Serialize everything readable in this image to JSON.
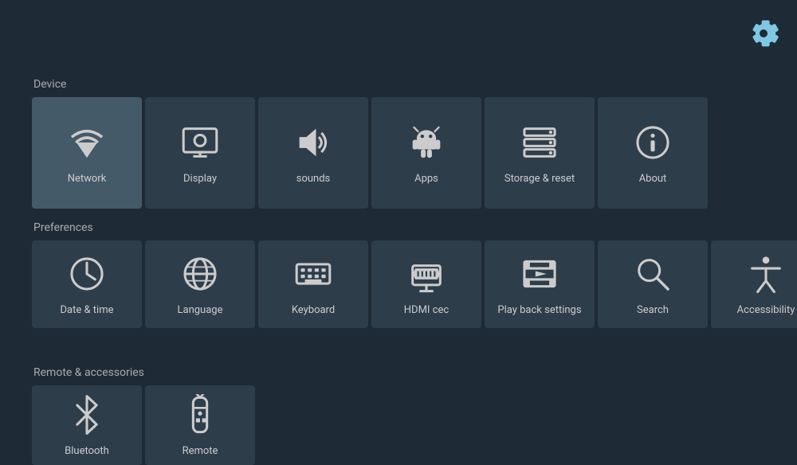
{
  "settings_icon": "gear-icon",
  "sections": {
    "device": {
      "label": "Device",
      "tiles": [
        {
          "id": "network",
          "label": "Network",
          "icon": "wifi",
          "active": true
        },
        {
          "id": "display",
          "label": "Display",
          "icon": "display",
          "active": false
        },
        {
          "id": "sounds",
          "label": "sounds",
          "icon": "volume",
          "active": false
        },
        {
          "id": "apps",
          "label": "Apps",
          "icon": "apps",
          "active": false
        },
        {
          "id": "storage-reset",
          "label": "Storage & reset",
          "icon": "storage",
          "active": false
        },
        {
          "id": "about",
          "label": "About",
          "icon": "info",
          "active": false
        }
      ]
    },
    "preferences": {
      "label": "Preferences",
      "tiles": [
        {
          "id": "date-time",
          "label": "Date & time",
          "icon": "clock"
        },
        {
          "id": "language",
          "label": "Language",
          "icon": "globe"
        },
        {
          "id": "keyboard",
          "label": "Keyboard",
          "icon": "keyboard"
        },
        {
          "id": "hdmi-cec",
          "label": "HDMI cec",
          "icon": "hdmi"
        },
        {
          "id": "playback",
          "label": "Play back settings",
          "icon": "film"
        },
        {
          "id": "search",
          "label": "Search",
          "icon": "search"
        },
        {
          "id": "accessibility",
          "label": "Accessibility",
          "icon": "accessibility"
        }
      ]
    },
    "remote": {
      "label": "Remote & accessories",
      "tiles": [
        {
          "id": "bluetooth",
          "label": "Bluetooth",
          "icon": "bluetooth"
        },
        {
          "id": "remote",
          "label": "Remote",
          "icon": "remote"
        }
      ]
    }
  }
}
